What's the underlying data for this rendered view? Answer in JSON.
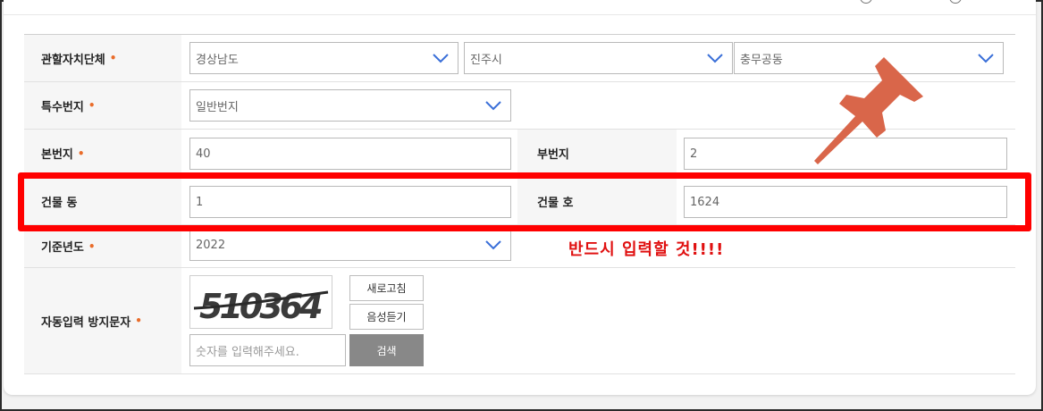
{
  "form": {
    "region": {
      "label": "관할자치단체",
      "province": "경상남도",
      "city": "진주시",
      "dong": "충무공동"
    },
    "special_lot": {
      "label": "특수번지",
      "value": "일반번지"
    },
    "main_lot": {
      "label": "본번지",
      "value": "40"
    },
    "sub_lot": {
      "label": "부번지",
      "value": "2"
    },
    "building_dong": {
      "label": "건물 동",
      "value": "1"
    },
    "building_ho": {
      "label": "건물 호",
      "value": "1624"
    },
    "base_year": {
      "label": "기준년도",
      "value": "2022"
    },
    "captcha": {
      "label": "자동입력 방지문자",
      "image_text": "510364",
      "refresh_label": "새로고침",
      "audio_label": "음성듣기",
      "input_placeholder": "숫자를 입력해주세요.",
      "search_label": "검색"
    },
    "required_mark": "•"
  },
  "annotation": {
    "note": "반드시 입력할 것!!!!",
    "highlight_color": "#ff0000",
    "pin_color": "#d9664a"
  }
}
